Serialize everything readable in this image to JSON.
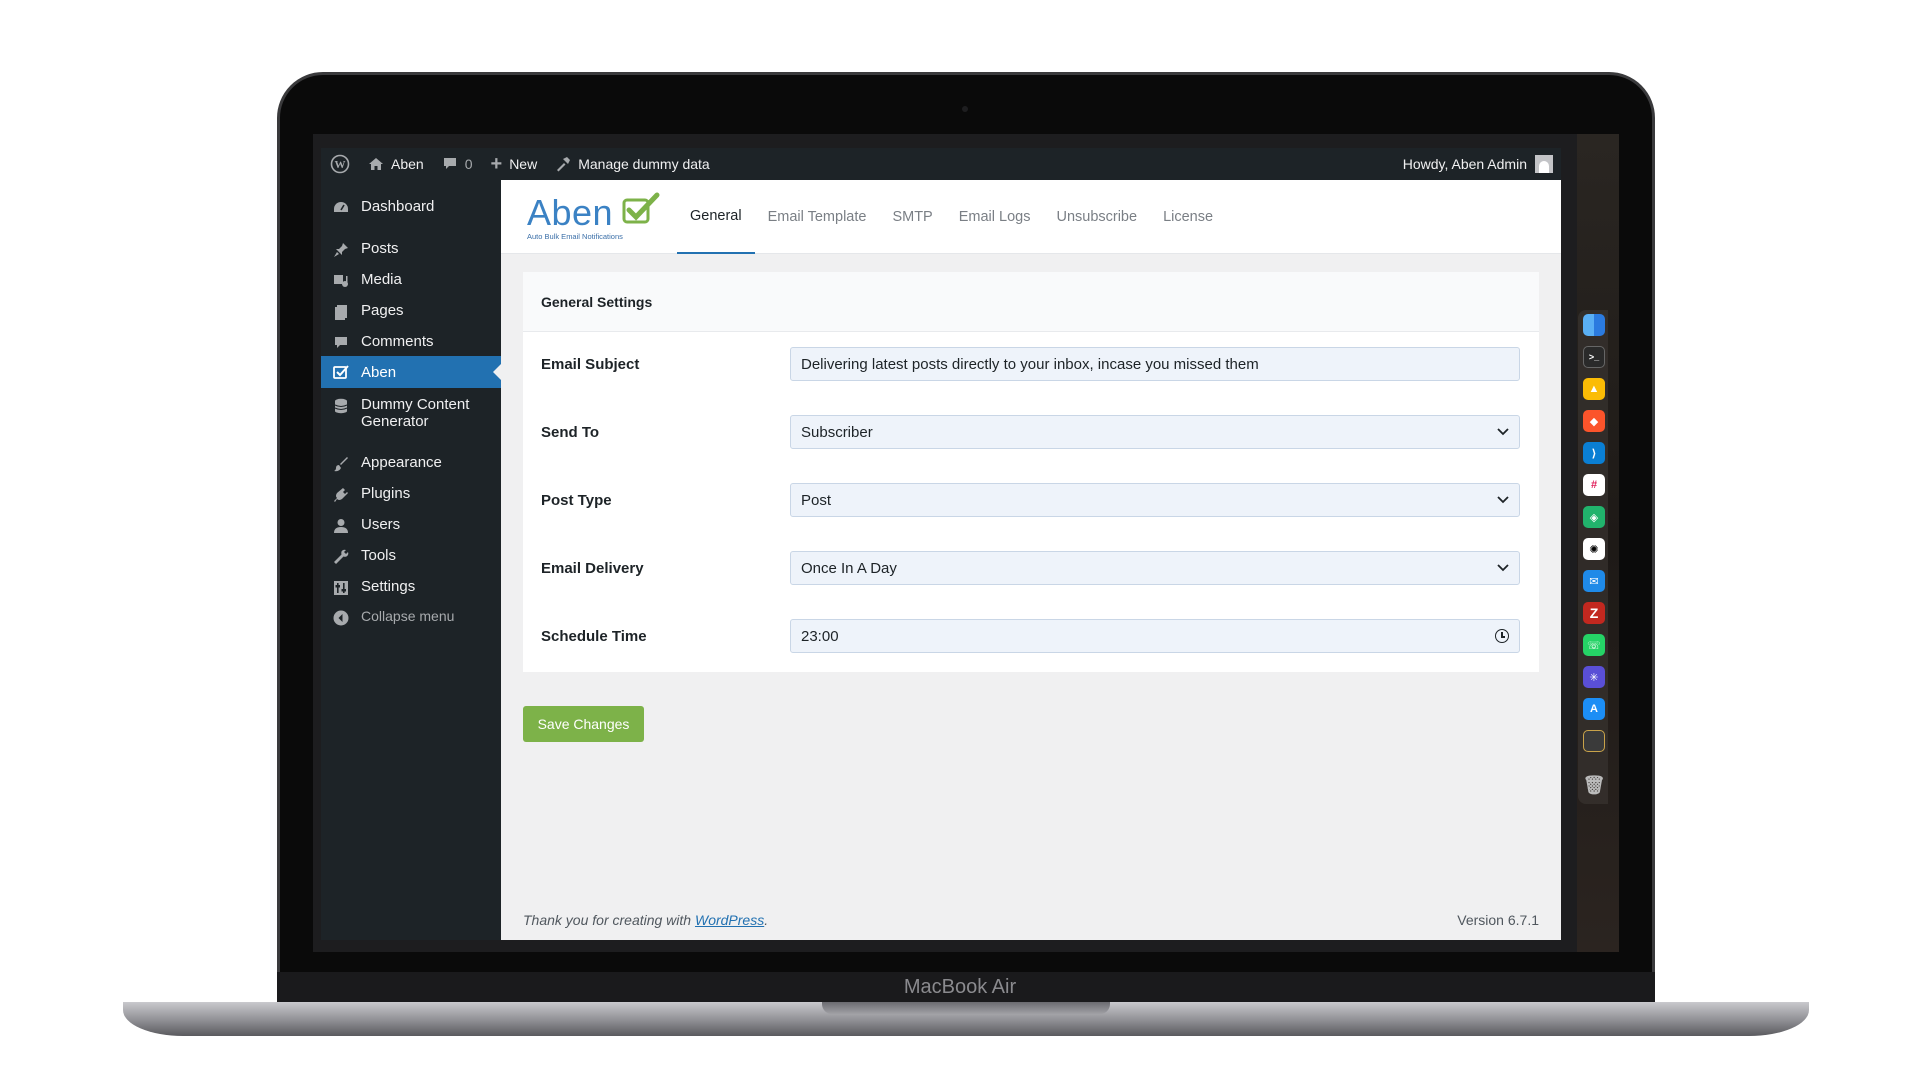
{
  "adminbar": {
    "site_name": "Aben",
    "comments_count": "0",
    "new_label": "New",
    "manage_label": "Manage dummy data",
    "howdy": "Howdy, Aben Admin"
  },
  "sidebar": {
    "items": [
      {
        "label": "Dashboard",
        "icon": "dashboard-icon"
      },
      {
        "label": "Posts",
        "icon": "pin-icon"
      },
      {
        "label": "Media",
        "icon": "media-icon"
      },
      {
        "label": "Pages",
        "icon": "pages-icon"
      },
      {
        "label": "Comments",
        "icon": "comment-icon"
      },
      {
        "label": "Aben",
        "icon": "send-icon"
      },
      {
        "label": "Dummy Content Generator",
        "icon": "database-icon"
      },
      {
        "label": "Appearance",
        "icon": "brush-icon"
      },
      {
        "label": "Plugins",
        "icon": "plug-icon"
      },
      {
        "label": "Users",
        "icon": "user-icon"
      },
      {
        "label": "Tools",
        "icon": "wrench-icon"
      },
      {
        "label": "Settings",
        "icon": "settings-icon"
      }
    ],
    "collapse_label": "Collapse menu"
  },
  "logo": {
    "word": "Aben",
    "tagline": "Auto Bulk Email Notifications"
  },
  "tabs": [
    {
      "label": "General"
    },
    {
      "label": "Email Template"
    },
    {
      "label": "SMTP"
    },
    {
      "label": "Email Logs"
    },
    {
      "label": "Unsubscribe"
    },
    {
      "label": "License"
    }
  ],
  "settings": {
    "heading": "General Settings",
    "email_subject": {
      "label": "Email Subject",
      "value": "Delivering latest posts directly to your inbox, incase you missed them"
    },
    "send_to": {
      "label": "Send To",
      "value": "Subscriber"
    },
    "post_type": {
      "label": "Post Type",
      "value": "Post"
    },
    "email_delivery": {
      "label": "Email Delivery",
      "value": "Once In A Day"
    },
    "schedule_time": {
      "label": "Schedule Time",
      "value": "23:00"
    }
  },
  "save_label": "Save Changes",
  "footer": {
    "thanks_prefix": "Thank you for creating with ",
    "thanks_link": "WordPress",
    "thanks_suffix": ".",
    "version": "Version 6.7.1"
  },
  "device_label": "MacBook Air",
  "colors": {
    "accent": "#2271b1",
    "adminbar": "#1d2327",
    "save_button": "#7db249",
    "logo_blue": "#3b82c4",
    "logo_green": "#7db249"
  }
}
